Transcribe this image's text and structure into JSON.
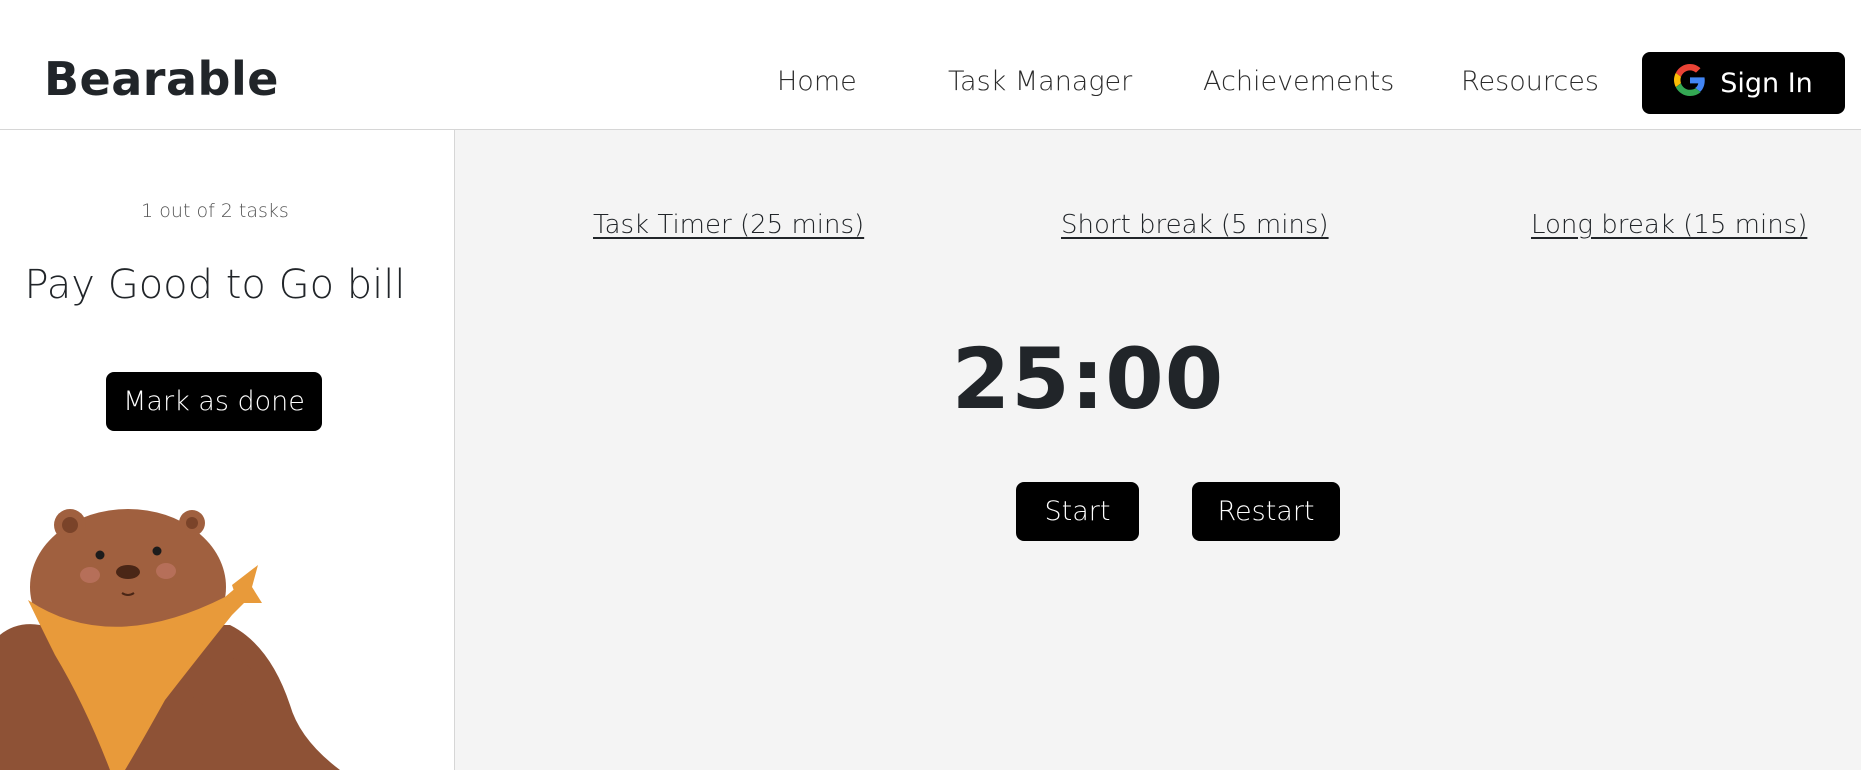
{
  "header": {
    "brand": "Bearable",
    "nav": [
      {
        "label": "Home"
      },
      {
        "label": "Task Manager"
      },
      {
        "label": "Achievements"
      },
      {
        "label": "Resources"
      }
    ],
    "signin_label": "Sign In",
    "signin_icon": "google-icon"
  },
  "sidebar": {
    "task_count": "1 out of 2 tasks",
    "task_title": "Pay Good to Go bill",
    "mark_done_label": "Mark as done",
    "illustration": "bear-illustration"
  },
  "main": {
    "tabs": [
      {
        "label": "Task Timer (25 mins)"
      },
      {
        "label": "Short break (5 mins)"
      },
      {
        "label": "Long break (15 mins)"
      }
    ],
    "timer": "25:00",
    "start_label": "Start",
    "restart_label": "Restart"
  },
  "colors": {
    "button_bg": "#000000",
    "main_bg": "#f4f4f4",
    "text": "#212529",
    "bear_brown": "#9a5a3c",
    "bandana_orange": "#e89a3a"
  }
}
